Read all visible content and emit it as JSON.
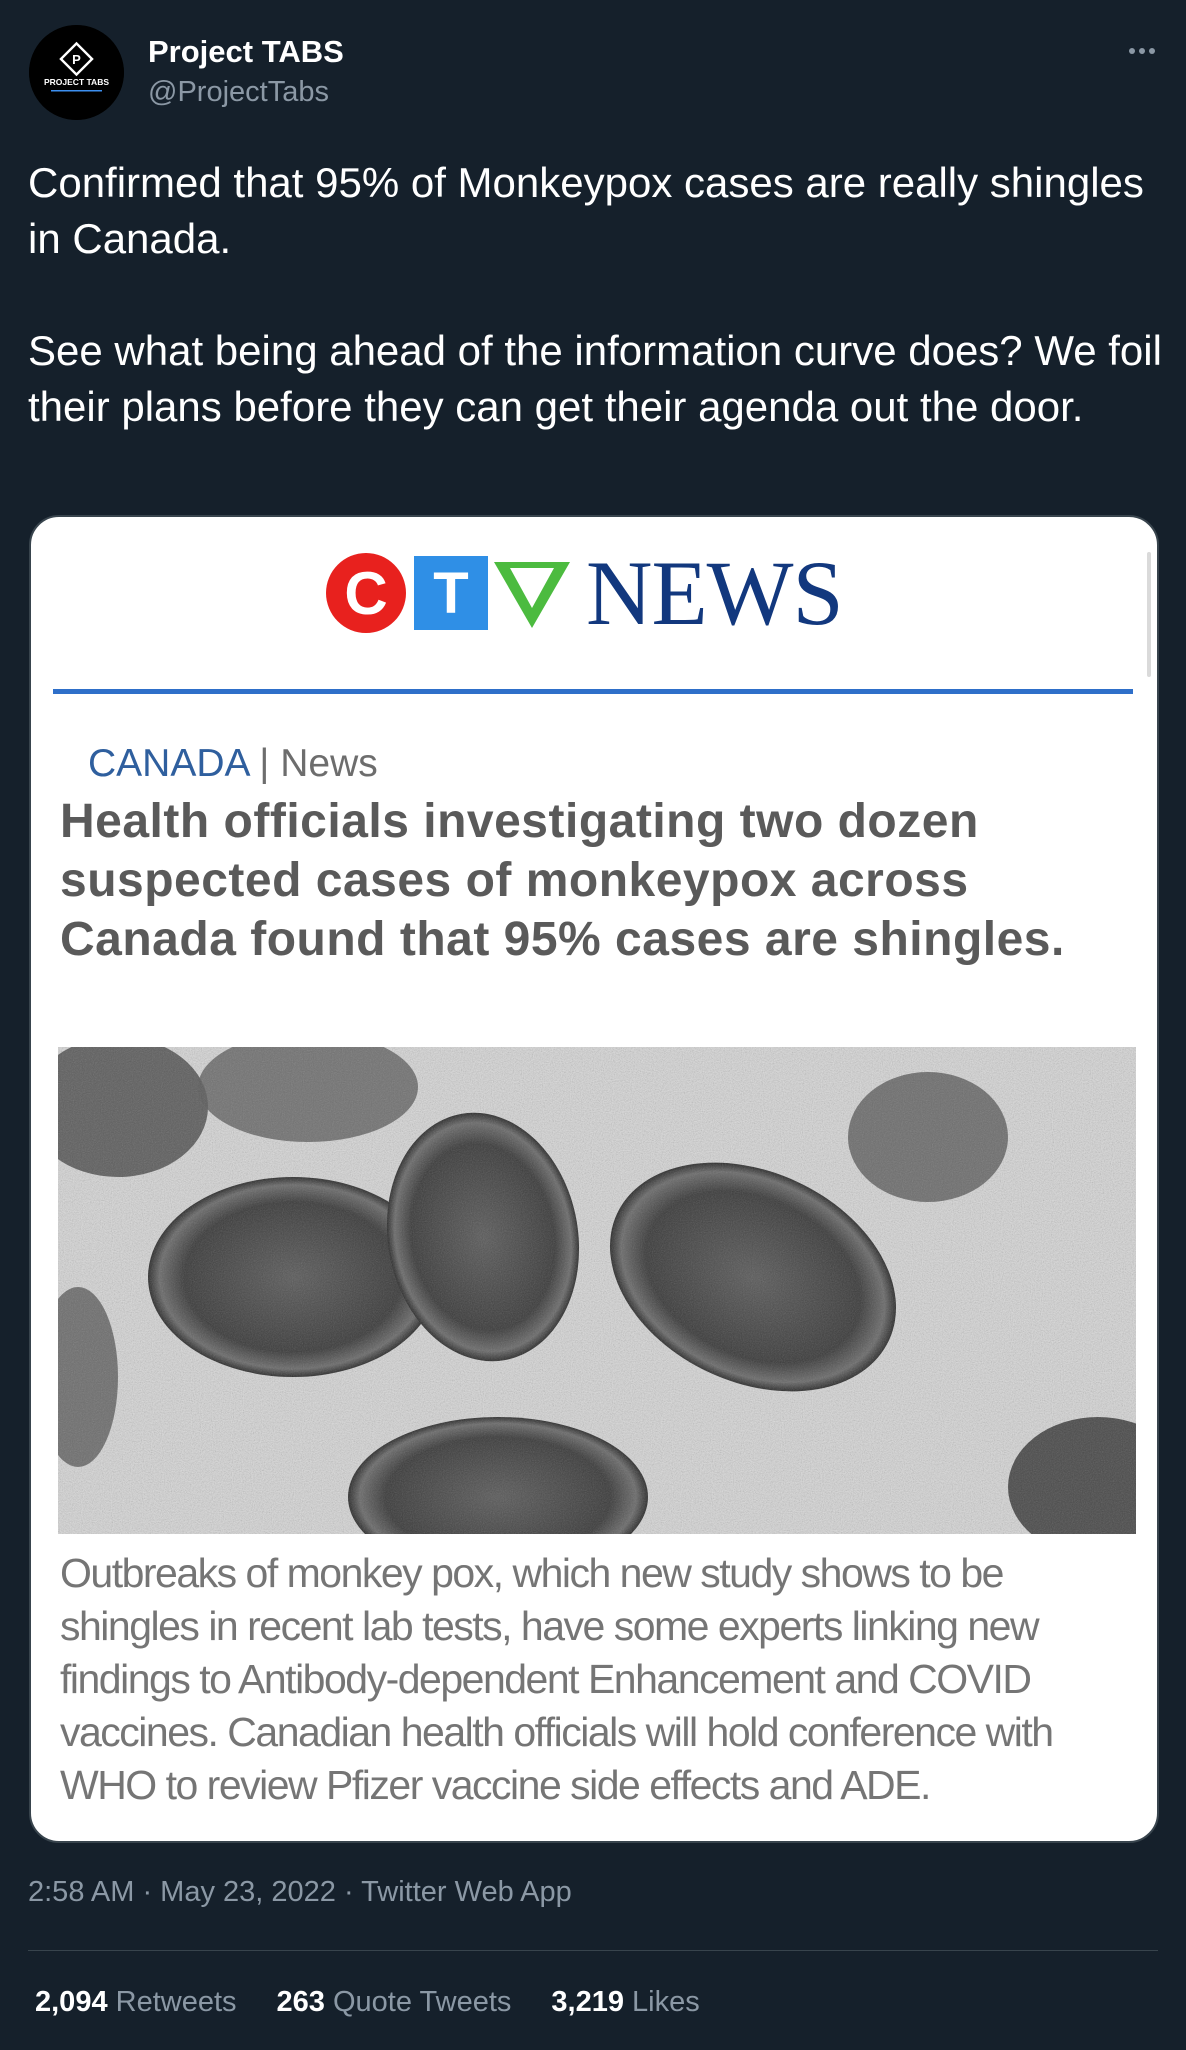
{
  "author": {
    "display_name": "Project TABS",
    "handle": "@ProjectTabs",
    "avatar_text": "PROJECT TABS"
  },
  "tweet": {
    "paragraphs": [
      "Confirmed that 95% of Monkeypox cases are really shingles in Canada.",
      "See what being ahead of the information curve does? We foil their plans before they can get their agenda out the door."
    ]
  },
  "media": {
    "logo": {
      "c": "C",
      "t": "T",
      "news": "NEWS"
    },
    "kicker_section": "CANADA",
    "kicker_separator": "|",
    "kicker_category": "News",
    "headline": "Health officials investigating two dozen suspected cases of monkeypox across Canada found that 95% cases are shingles.",
    "caption": "Outbreaks of monkey pox, which new study shows to be shingles in recent lab tests, have some experts linking new findings to Antibody-dependent Enhancement and COVID vaccines. Canadian health officials will hold conference with WHO to review Pfizer vaccine side effects and ADE."
  },
  "meta": {
    "timestamp": "2:58 AM · May 23, 2022 · Twitter Web App"
  },
  "stats": [
    {
      "count": "2,094",
      "label": "Retweets"
    },
    {
      "count": "263",
      "label": "Quote Tweets"
    },
    {
      "count": "3,219",
      "label": "Likes"
    }
  ],
  "colors": {
    "background": "#15202b",
    "secondary_text": "#8b98a5",
    "ctv_red": "#e8211e",
    "ctv_blue": "#2f8fe6",
    "ctv_green": "#4cbb3f",
    "ctv_navy": "#12387e"
  },
  "icons": {
    "more": "more-horizontal-icon"
  }
}
